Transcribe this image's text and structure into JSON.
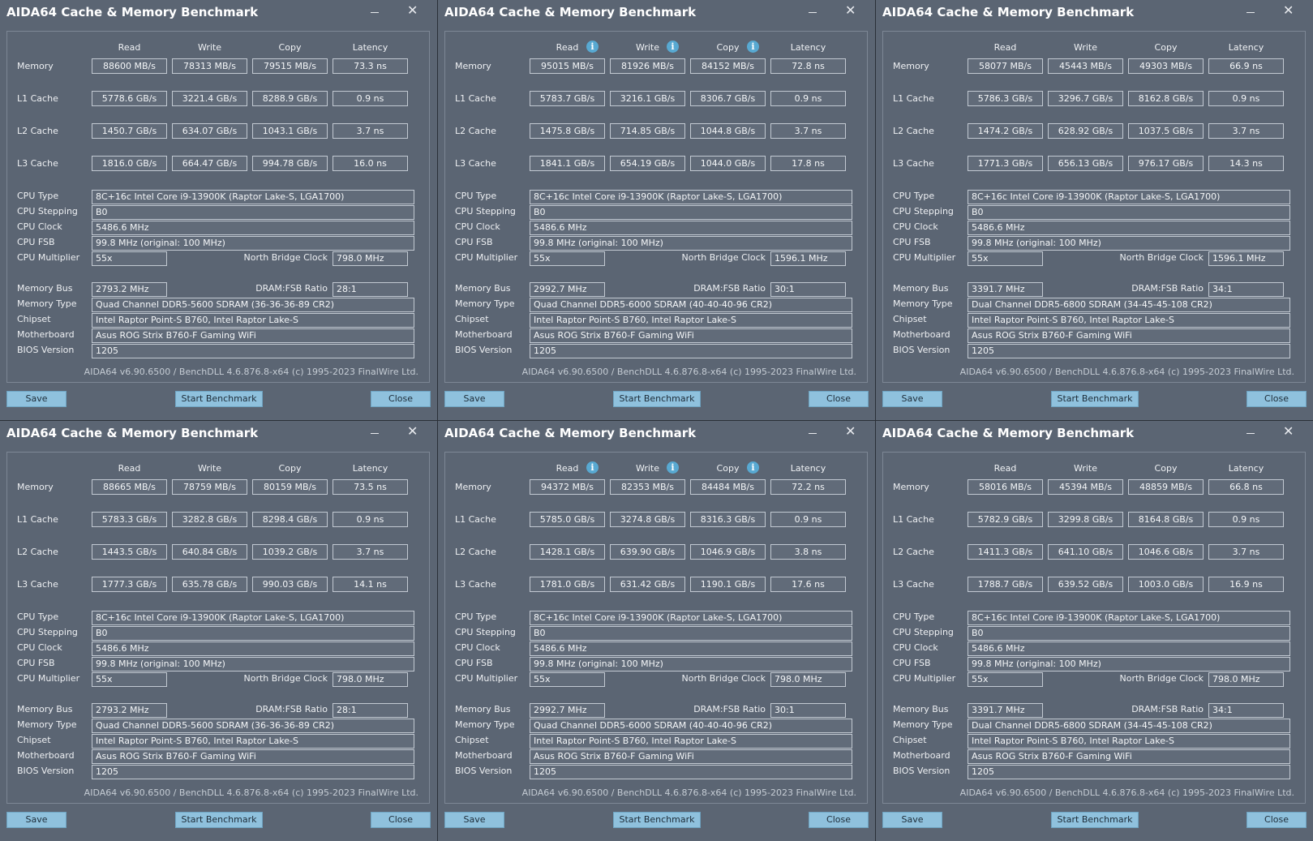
{
  "common": {
    "title": "AIDA64 Cache & Memory Benchmark",
    "headers": {
      "read": "Read",
      "write": "Write",
      "copy": "Copy",
      "latency": "Latency"
    },
    "row_labels": {
      "memory": "Memory",
      "l1": "L1 Cache",
      "l2": "L2 Cache",
      "l3": "L3 Cache"
    },
    "info_labels": {
      "cpu_type": "CPU Type",
      "cpu_stepping": "CPU Stepping",
      "cpu_clock": "CPU Clock",
      "cpu_fsb": "CPU FSB",
      "cpu_multiplier": "CPU Multiplier",
      "nb_clock": "North Bridge Clock",
      "memory_bus": "Memory Bus",
      "dram_fsb": "DRAM:FSB Ratio",
      "memory_type": "Memory Type",
      "chipset": "Chipset",
      "motherboard": "Motherboard",
      "bios": "BIOS Version"
    },
    "footer": "AIDA64 v6.90.6500 / BenchDLL 4.6.876.8-x64  (c) 1995-2023 FinalWire Ltd.",
    "buttons": {
      "save": "Save",
      "start": "Start Benchmark",
      "close": "Close"
    },
    "info_icon": "info-icon",
    "colors": {
      "window_bg": "#5b6573",
      "field_border": "#c2c9d2",
      "button_bg": "#8fc1dd",
      "info_icon": "#58a9d2"
    }
  },
  "windows": [
    {
      "memory": [
        "88600 MB/s",
        "78313 MB/s",
        "79515 MB/s",
        "73.3 ns"
      ],
      "l1": [
        "5778.6 GB/s",
        "3221.4 GB/s",
        "8288.9 GB/s",
        "0.9 ns"
      ],
      "l2": [
        "1450.7 GB/s",
        "634.07 GB/s",
        "1043.1 GB/s",
        "3.7 ns"
      ],
      "l3": [
        "1816.0 GB/s",
        "664.47 GB/s",
        "994.78 GB/s",
        "16.0 ns"
      ],
      "cpu_type": "8C+16c Intel Core i9-13900K  (Raptor Lake-S, LGA1700)",
      "cpu_stepping": "B0",
      "cpu_clock": "5486.6 MHz",
      "cpu_fsb": "99.8 MHz  (original: 100 MHz)",
      "cpu_multiplier": "55x",
      "nb_clock": "798.0 MHz",
      "memory_bus": "2793.2 MHz",
      "dram_fsb": "28:1",
      "memory_type": "Quad Channel DDR5-5600 SDRAM  (36-36-36-89 CR2)",
      "chipset": "Intel Raptor Point-S B760, Intel Raptor Lake-S",
      "motherboard": "Asus ROG Strix B760-F Gaming WiFi",
      "bios": "1205"
    },
    {
      "memory": [
        "95015 MB/s",
        "81926 MB/s",
        "84152 MB/s",
        "72.8 ns"
      ],
      "l1": [
        "5783.7 GB/s",
        "3216.1 GB/s",
        "8306.7 GB/s",
        "0.9 ns"
      ],
      "l2": [
        "1475.8 GB/s",
        "714.85 GB/s",
        "1044.8 GB/s",
        "3.7 ns"
      ],
      "l3": [
        "1841.1 GB/s",
        "654.19 GB/s",
        "1044.0 GB/s",
        "17.8 ns"
      ],
      "cpu_type": "8C+16c Intel Core i9-13900K  (Raptor Lake-S, LGA1700)",
      "cpu_stepping": "B0",
      "cpu_clock": "5486.6 MHz",
      "cpu_fsb": "99.8 MHz  (original: 100 MHz)",
      "cpu_multiplier": "55x",
      "nb_clock": "1596.1 MHz",
      "memory_bus": "2992.7 MHz",
      "dram_fsb": "30:1",
      "memory_type": "Quad Channel DDR5-6000 SDRAM  (40-40-40-96 CR2)",
      "chipset": "Intel Raptor Point-S B760, Intel Raptor Lake-S",
      "motherboard": "Asus ROG Strix B760-F Gaming WiFi",
      "bios": "1205"
    },
    {
      "memory": [
        "58077 MB/s",
        "45443 MB/s",
        "49303 MB/s",
        "66.9 ns"
      ],
      "l1": [
        "5786.3 GB/s",
        "3296.7 GB/s",
        "8162.8 GB/s",
        "0.9 ns"
      ],
      "l2": [
        "1474.2 GB/s",
        "628.92 GB/s",
        "1037.5 GB/s",
        "3.7 ns"
      ],
      "l3": [
        "1771.3 GB/s",
        "656.13 GB/s",
        "976.17 GB/s",
        "14.3 ns"
      ],
      "cpu_type": "8C+16c Intel Core i9-13900K  (Raptor Lake-S, LGA1700)",
      "cpu_stepping": "B0",
      "cpu_clock": "5486.6 MHz",
      "cpu_fsb": "99.8 MHz  (original: 100 MHz)",
      "cpu_multiplier": "55x",
      "nb_clock": "1596.1 MHz",
      "memory_bus": "3391.7 MHz",
      "dram_fsb": "34:1",
      "memory_type": "Dual Channel DDR5-6800 SDRAM  (34-45-45-108 CR2)",
      "chipset": "Intel Raptor Point-S B760, Intel Raptor Lake-S",
      "motherboard": "Asus ROG Strix B760-F Gaming WiFi",
      "bios": "1205"
    },
    {
      "memory": [
        "88665 MB/s",
        "78759 MB/s",
        "80159 MB/s",
        "73.5 ns"
      ],
      "l1": [
        "5783.3 GB/s",
        "3282.8 GB/s",
        "8298.4 GB/s",
        "0.9 ns"
      ],
      "l2": [
        "1443.5 GB/s",
        "640.84 GB/s",
        "1039.2 GB/s",
        "3.7 ns"
      ],
      "l3": [
        "1777.3 GB/s",
        "635.78 GB/s",
        "990.03 GB/s",
        "14.1 ns"
      ],
      "cpu_type": "8C+16c Intel Core i9-13900K  (Raptor Lake-S, LGA1700)",
      "cpu_stepping": "B0",
      "cpu_clock": "5486.6 MHz",
      "cpu_fsb": "99.8 MHz  (original: 100 MHz)",
      "cpu_multiplier": "55x",
      "nb_clock": "798.0 MHz",
      "memory_bus": "2793.2 MHz",
      "dram_fsb": "28:1",
      "memory_type": "Quad Channel DDR5-5600 SDRAM  (36-36-36-89 CR2)",
      "chipset": "Intel Raptor Point-S B760, Intel Raptor Lake-S",
      "motherboard": "Asus ROG Strix B760-F Gaming WiFi",
      "bios": "1205"
    },
    {
      "memory": [
        "94372 MB/s",
        "82353 MB/s",
        "84484 MB/s",
        "72.2 ns"
      ],
      "l1": [
        "5785.0 GB/s",
        "3274.8 GB/s",
        "8316.3 GB/s",
        "0.9 ns"
      ],
      "l2": [
        "1428.1 GB/s",
        "639.90 GB/s",
        "1046.9 GB/s",
        "3.8 ns"
      ],
      "l3": [
        "1781.0 GB/s",
        "631.42 GB/s",
        "1190.1 GB/s",
        "17.6 ns"
      ],
      "cpu_type": "8C+16c Intel Core i9-13900K  (Raptor Lake-S, LGA1700)",
      "cpu_stepping": "B0",
      "cpu_clock": "5486.6 MHz",
      "cpu_fsb": "99.8 MHz  (original: 100 MHz)",
      "cpu_multiplier": "55x",
      "nb_clock": "798.0 MHz",
      "memory_bus": "2992.7 MHz",
      "dram_fsb": "30:1",
      "memory_type": "Quad Channel DDR5-6000 SDRAM  (40-40-40-96 CR2)",
      "chipset": "Intel Raptor Point-S B760, Intel Raptor Lake-S",
      "motherboard": "Asus ROG Strix B760-F Gaming WiFi",
      "bios": "1205"
    },
    {
      "memory": [
        "58016 MB/s",
        "45394 MB/s",
        "48859 MB/s",
        "66.8 ns"
      ],
      "l1": [
        "5782.9 GB/s",
        "3299.8 GB/s",
        "8164.8 GB/s",
        "0.9 ns"
      ],
      "l2": [
        "1411.3 GB/s",
        "641.10 GB/s",
        "1046.6 GB/s",
        "3.7 ns"
      ],
      "l3": [
        "1788.7 GB/s",
        "639.52 GB/s",
        "1003.0 GB/s",
        "16.9 ns"
      ],
      "cpu_type": "8C+16c Intel Core i9-13900K  (Raptor Lake-S, LGA1700)",
      "cpu_stepping": "B0",
      "cpu_clock": "5486.6 MHz",
      "cpu_fsb": "99.8 MHz  (original: 100 MHz)",
      "cpu_multiplier": "55x",
      "nb_clock": "798.0 MHz",
      "memory_bus": "3391.7 MHz",
      "dram_fsb": "34:1",
      "memory_type": "Dual Channel DDR5-6800 SDRAM  (34-45-45-108 CR2)",
      "chipset": "Intel Raptor Point-S B760, Intel Raptor Lake-S",
      "motherboard": "Asus ROG Strix B760-F Gaming WiFi",
      "bios": "1205"
    }
  ]
}
